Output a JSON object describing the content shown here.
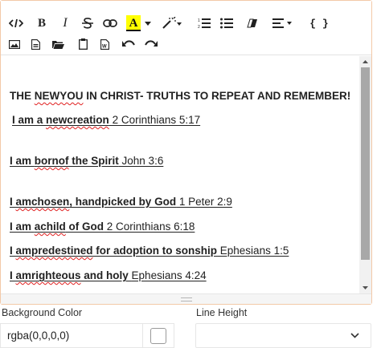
{
  "editor": {
    "toolbar": {
      "row1": [
        "code-view",
        "bold",
        "italic",
        "strikethrough",
        "link",
        "font-color",
        "magic-wand",
        "ordered-list",
        "unordered-list",
        "eraser",
        "align",
        "braces"
      ],
      "row2": [
        "image",
        "file",
        "folder",
        "clipboard",
        "word-doc",
        "undo",
        "redo"
      ],
      "bold_label": "B",
      "italic_label": "I",
      "font_color_label": "A",
      "braces_label": "{ }",
      "colors": {
        "highlight": "#ffff00",
        "accent": "#f3c9a8"
      }
    },
    "content": {
      "heading": {
        "pre": "THE ",
        "spell": "NEWYOU",
        "post": " IN CHRIST-  TRUTHS TO REPEAT AND REMEMBER!"
      },
      "lines": [
        {
          "bold_pre": "I am a ",
          "bold_spell": "newcreation",
          "bold_post": "",
          "ref": " 2 Corinthians 5:17"
        },
        {
          "bold_pre": "I am ",
          "bold_spell": "bornof",
          "bold_post": " the Spirit",
          "ref": " John 3:6"
        },
        {
          "bold_pre": "I ",
          "bold_spell": "amchosen",
          "bold_post": ", handpicked by God",
          "ref": " 1 Peter 2:9"
        },
        {
          "bold_pre": "I am ",
          "bold_spell": "achild",
          "bold_post": " of God",
          "ref": " 2 Corinthians 6:18 "
        },
        {
          "bold_pre": "I ",
          "bold_spell": "ampredestined",
          "bold_post": " for adoption to sonship",
          "ref": " Ephesians 1:5"
        },
        {
          "bold_pre": "I ",
          "bold_spell": "amrighteous",
          "bold_post": " and holy ",
          "ref": " Ephesians 4:24"
        }
      ]
    }
  },
  "background_color": {
    "label": "Background Color",
    "value": "rgba(0,0,0,0)"
  },
  "line_height": {
    "label": "Line Height",
    "value": ""
  }
}
